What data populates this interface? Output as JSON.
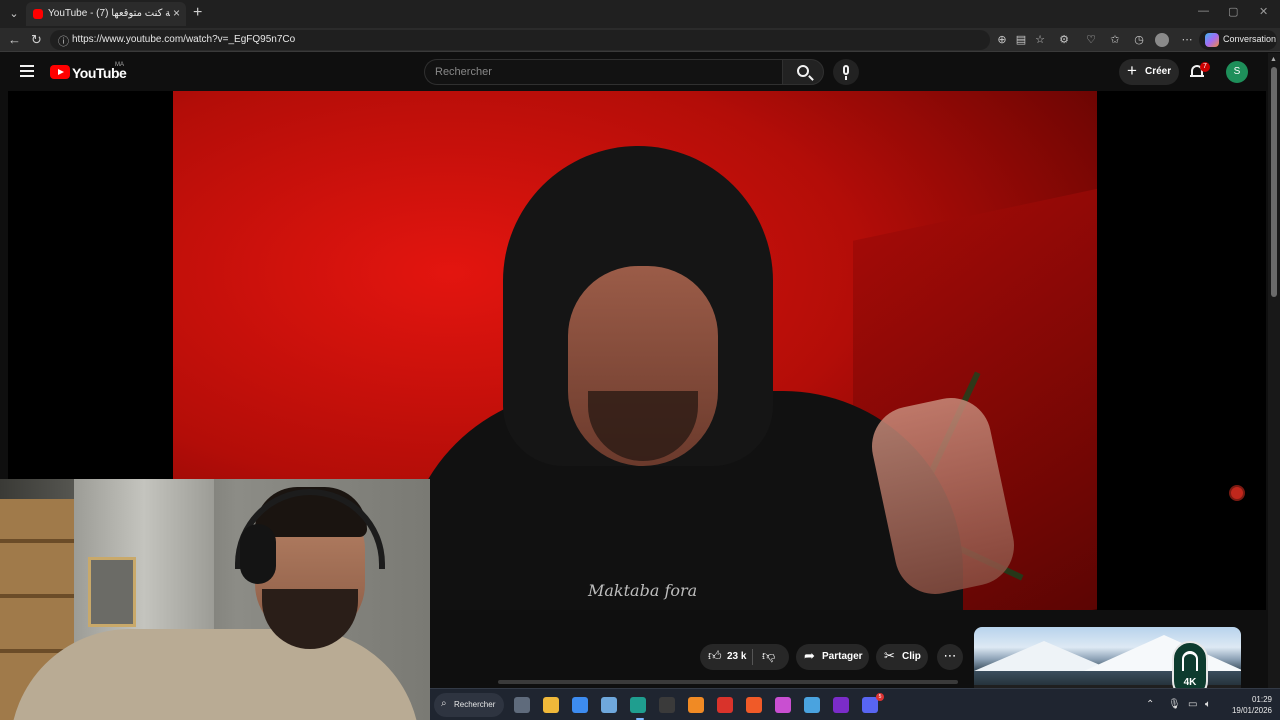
{
  "browser": {
    "tab": {
      "title": "YouTube - (7) آخر حاجة كنت متوقعها",
      "close_icon": "×"
    },
    "new_tab_icon": "+",
    "window_controls": {
      "minimize": "—",
      "maximize": "▢",
      "close": "✕"
    },
    "url": "https://www.youtube.com/watch?v=_EgFQ95n7Co",
    "conversation_label": "Conversation",
    "more_icon": "⋯"
  },
  "youtube": {
    "logo_text": "YouTube",
    "country_code": "MA",
    "search_placeholder": "Rechercher",
    "create_label": "Créer",
    "notification_count": "7",
    "avatar_letter": "S",
    "hoodie_text": "Maktaba fora",
    "actions": {
      "like_count": "23 k",
      "share_label": "Partager",
      "clip_label": "Clip",
      "more_icon": "⋯"
    },
    "watermark_text": "4K"
  },
  "taskbar": {
    "search_label": "Rechercher",
    "time": "01:29",
    "date": "19/01/2026",
    "discord_badge": "5",
    "apps": [
      {
        "name": "task-view",
        "color": "#5f6b7c"
      },
      {
        "name": "file-explorer",
        "color": "#f0b93a"
      },
      {
        "name": "microsoft-store",
        "color": "#3d8cf0"
      },
      {
        "name": "photos",
        "color": "#6fa8dc"
      },
      {
        "name": "edge",
        "color": "#1f9e8f"
      },
      {
        "name": "obs",
        "color": "#3a3a3a"
      },
      {
        "name": "app-orange",
        "color": "#f08a24"
      },
      {
        "name": "wps",
        "color": "#d9332b"
      },
      {
        "name": "brave",
        "color": "#f05a28"
      },
      {
        "name": "brave-beta",
        "color": "#c94fd1"
      },
      {
        "name": "window-app",
        "color": "#4aa3df"
      },
      {
        "name": "next",
        "color": "#7b2cc9"
      },
      {
        "name": "discord",
        "color": "#5865f2"
      }
    ]
  },
  "colors": {
    "yt_red": "#ff0000",
    "pill_bg": "#272727",
    "taskbar_bg": "#1f2530"
  }
}
